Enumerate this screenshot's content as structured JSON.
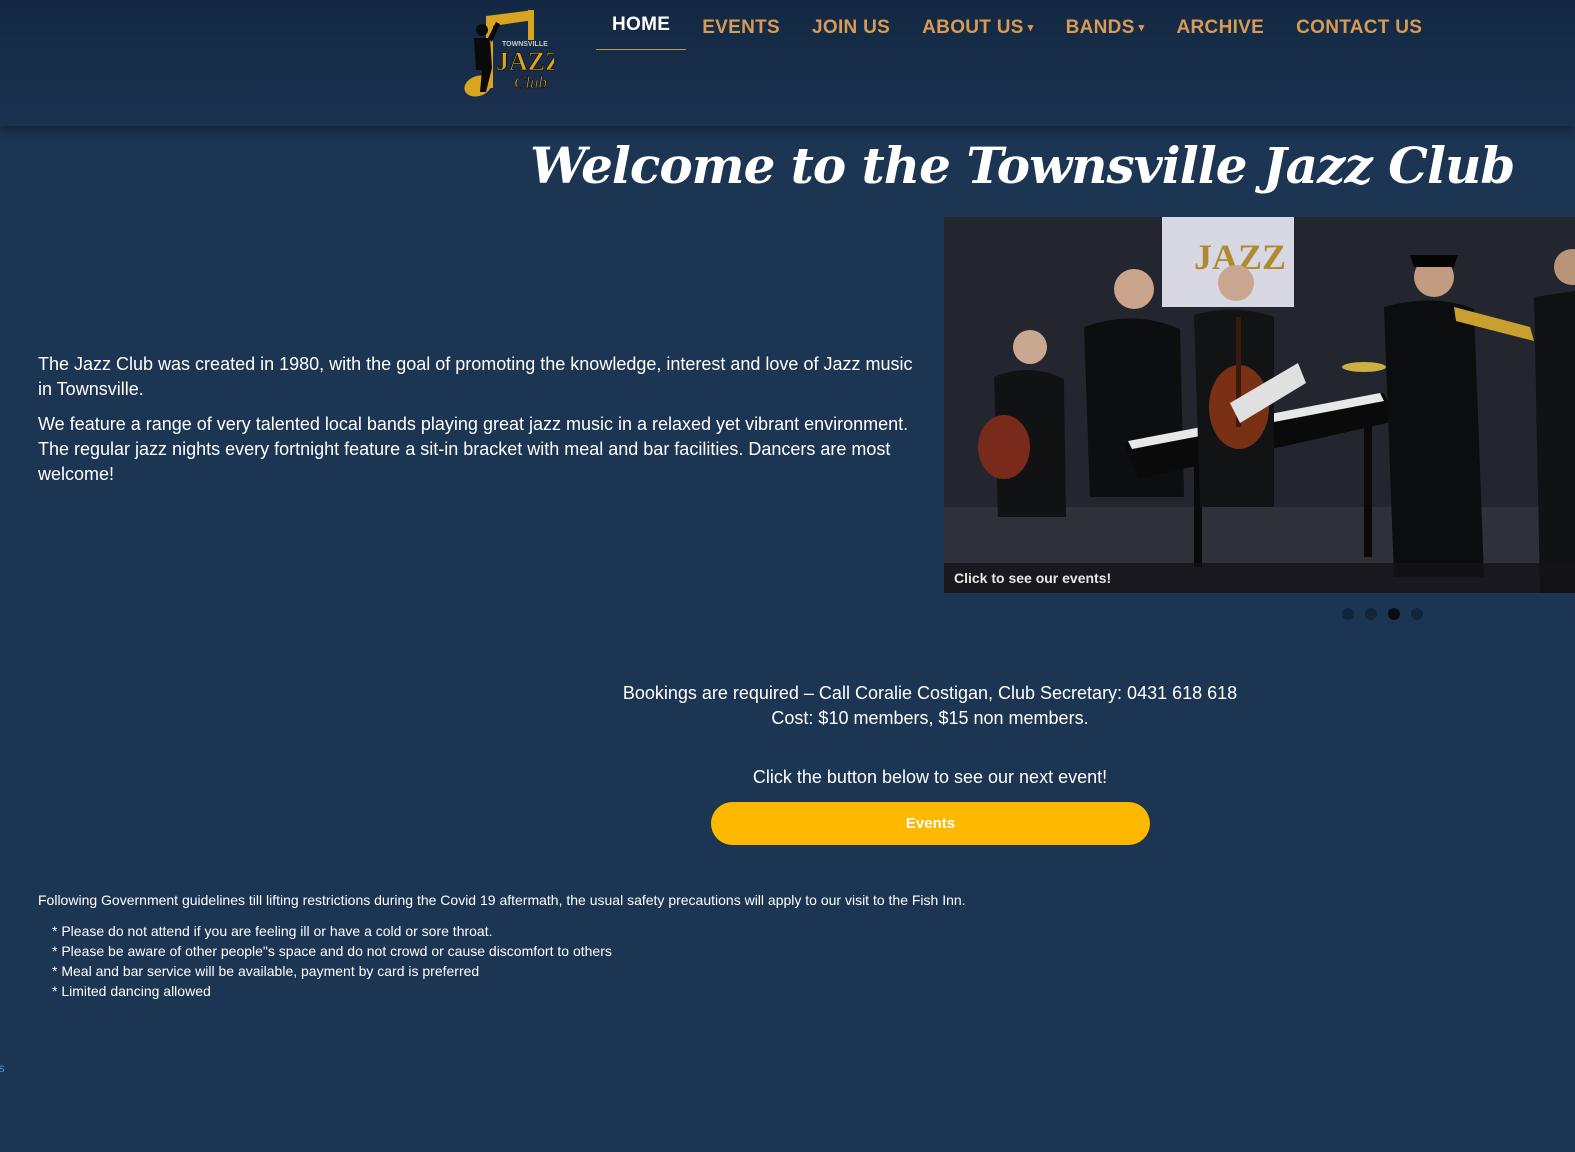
{
  "header": {
    "logo_alt": "Townsville Jazz Club",
    "nav": [
      {
        "label": "HOME"
      },
      {
        "label": "EVENTS"
      },
      {
        "label": "JOIN US"
      },
      {
        "label": "ABOUT US"
      },
      {
        "label": "BANDS"
      },
      {
        "label": "ARCHIVE"
      },
      {
        "label": "CONTACT US"
      }
    ],
    "dropdown_caret": "▾"
  },
  "welcome_title": "Welcome to the Townsville Jazz Club",
  "intro": {
    "p1": "The Jazz Club was created in 1980, with the goal of promoting the knowledge, interest and love of Jazz music in Townsville.",
    "p2": "We feature a range of very talented local bands playing great jazz music in a relaxed yet vibrant environment. The regular jazz nights every fortnight feature a sit-in bracket with meal and bar facilities. Dancers are most welcome!"
  },
  "slider": {
    "caption": "Click to see our events!",
    "slide_count": 4,
    "active_slide": 3
  },
  "bookings": {
    "line1": "Bookings are required – Call Coralie Costigan, Club Secretary:  0431 618 618",
    "line2": "Cost: $10 members, $15 non members."
  },
  "cta": {
    "text": "Click the button below to see our next event!",
    "button_label": "Events"
  },
  "covid": {
    "intro": "Following Government guidelines till lifting restrictions during the Covid 19 aftermath, the usual safety precautions will apply to our visit to the Fish Inn.",
    "items": [
      "* Please do not attend if you are feeling ill or have a cold or sore throat.",
      "* Please be aware of other people\"s space and do not crowd or cause discomfort to others",
      "* Meal and bar service will be available, payment by card is preferred",
      "* Limited dancing allowed"
    ]
  },
  "edge_link": "us",
  "colors": {
    "background": "#1c3553",
    "nav_text": "#d79b55",
    "button": "#ffb800",
    "logo_gold": "#d9a520"
  }
}
